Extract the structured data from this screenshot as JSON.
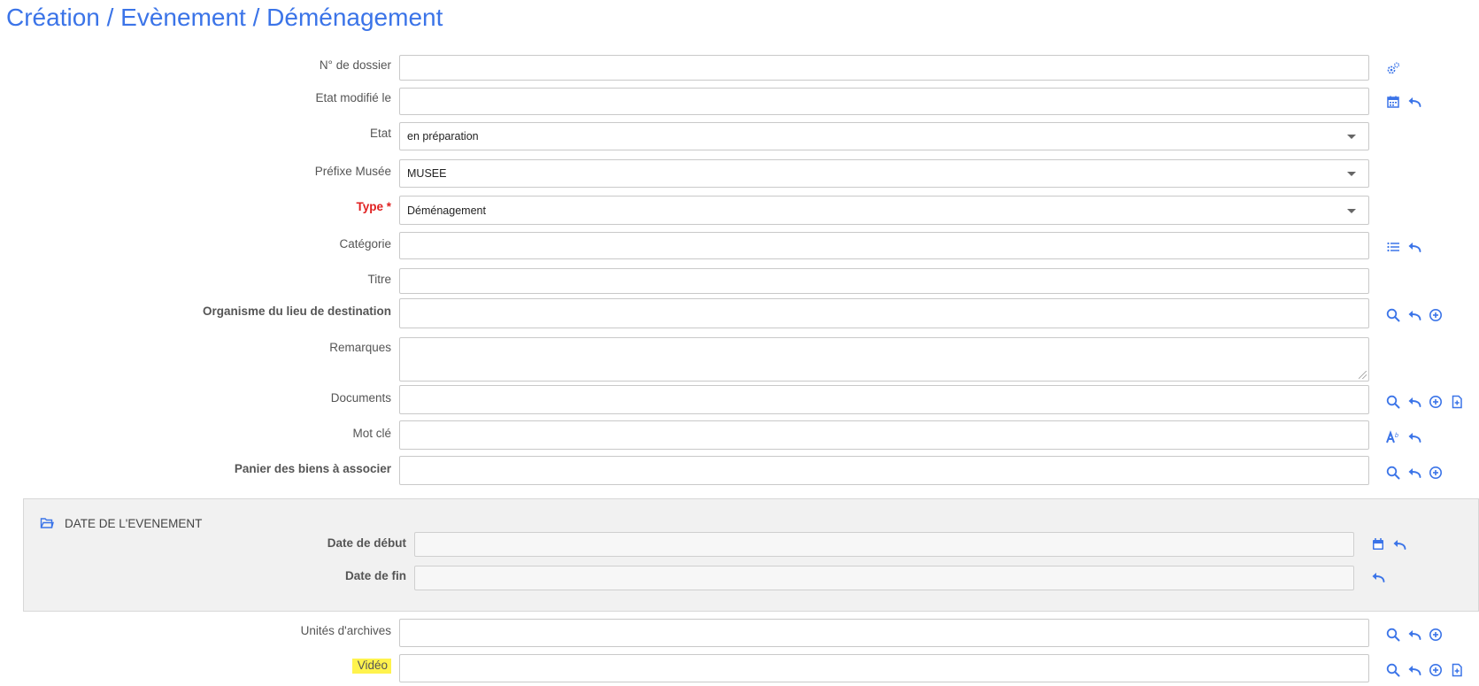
{
  "page": {
    "title": "Création / Evènement / Déménagement"
  },
  "fields": {
    "dossier": {
      "label": "N° de dossier",
      "value": ""
    },
    "etat_modifie": {
      "label": "Etat modifié le",
      "value": ""
    },
    "etat": {
      "label": "Etat",
      "value": "en préparation"
    },
    "prefixe": {
      "label": "Préfixe Musée",
      "value": "MUSEE"
    },
    "type": {
      "label": "Type *",
      "value": "Déménagement"
    },
    "categorie": {
      "label": "Catégorie",
      "value": ""
    },
    "titre": {
      "label": "Titre",
      "value": ""
    },
    "organisme": {
      "label": "Organisme du lieu de destination",
      "value": ""
    },
    "remarques": {
      "label": "Remarques",
      "value": ""
    },
    "documents": {
      "label": "Documents",
      "value": ""
    },
    "mot_cle": {
      "label": "Mot clé",
      "value": ""
    },
    "panier": {
      "label": "Panier des biens à associer",
      "value": ""
    },
    "unites": {
      "label": "Unités d'archives",
      "value": ""
    },
    "video": {
      "label": "Vidéo",
      "value": ""
    }
  },
  "section_date": {
    "title": "DATE DE L'EVENEMENT",
    "debut": {
      "label": "Date de début",
      "value": ""
    },
    "fin": {
      "label": "Date de fin",
      "value": ""
    }
  },
  "colors": {
    "accent": "#3b74e8",
    "required": "#e02020",
    "highlight": "#fff34d"
  },
  "icons": [
    "gears-icon",
    "calendar-icon",
    "undo-icon",
    "list-icon",
    "search-icon",
    "plus-circle-icon",
    "file-plus-icon",
    "text-format-icon",
    "folder-open-icon"
  ]
}
